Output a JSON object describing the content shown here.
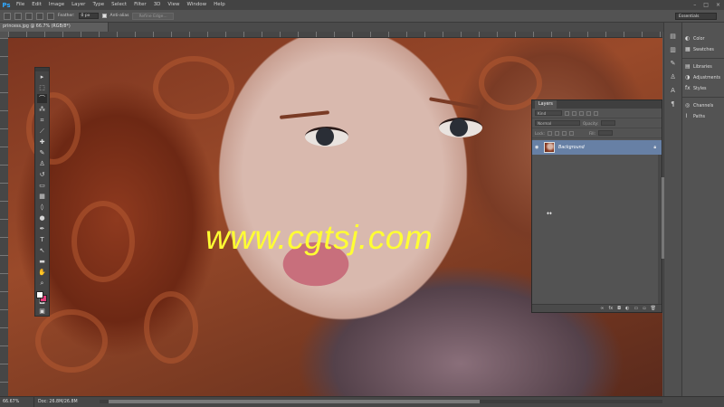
{
  "app": {
    "logo": "Ps"
  },
  "menu": [
    "File",
    "Edit",
    "Image",
    "Layer",
    "Type",
    "Select",
    "Filter",
    "3D",
    "View",
    "Window",
    "Help"
  ],
  "window_controls": [
    "–",
    "□",
    "×"
  ],
  "options_bar": {
    "feather_label": "Feather:",
    "feather_value": "0 px",
    "antialias_label": "Anti-alias",
    "refine_edge_label": "Refine Edge..."
  },
  "workspace": "Essentials",
  "document": {
    "tab_title": "princess.jpg @ 66.7% (RGB/8*)"
  },
  "watermark": "www.cgtsj.com",
  "toolbar": {
    "tools": [
      {
        "name": "move-tool",
        "glyph": "▸"
      },
      {
        "name": "marquee-tool",
        "glyph": "⬚"
      },
      {
        "name": "lasso-tool",
        "glyph": "⌒"
      },
      {
        "name": "quick-select-tool",
        "glyph": "⁂"
      },
      {
        "name": "crop-tool",
        "glyph": "⌗"
      },
      {
        "name": "eyedropper-tool",
        "glyph": "⟋"
      },
      {
        "name": "healing-brush-tool",
        "glyph": "✚"
      },
      {
        "name": "brush-tool",
        "glyph": "✎"
      },
      {
        "name": "clone-stamp-tool",
        "glyph": "♙"
      },
      {
        "name": "history-brush-tool",
        "glyph": "↺"
      },
      {
        "name": "eraser-tool",
        "glyph": "▭"
      },
      {
        "name": "gradient-tool",
        "glyph": "▦"
      },
      {
        "name": "blur-tool",
        "glyph": "◊"
      },
      {
        "name": "dodge-tool",
        "glyph": "●"
      },
      {
        "name": "pen-tool",
        "glyph": "✒"
      },
      {
        "name": "type-tool",
        "glyph": "T"
      },
      {
        "name": "path-select-tool",
        "glyph": "↖"
      },
      {
        "name": "rectangle-tool",
        "glyph": "▬"
      },
      {
        "name": "hand-tool",
        "glyph": "✋"
      },
      {
        "name": "zoom-tool",
        "glyph": "⌕"
      }
    ],
    "extra": [
      {
        "name": "quick-mask-button",
        "glyph": "◙"
      },
      {
        "name": "screen-mode-button",
        "glyph": "▣"
      }
    ]
  },
  "dock": {
    "items": [
      {
        "name": "color",
        "label": "Color",
        "glyph": "◐"
      },
      {
        "name": "swatches",
        "label": "Swatches",
        "glyph": "▦"
      },
      {
        "name": "libraries",
        "label": "Libraries",
        "glyph": "▤"
      },
      {
        "name": "adjustments",
        "label": "Adjustments",
        "glyph": "◑"
      },
      {
        "name": "styles",
        "label": "Styles",
        "glyph": "fx"
      },
      {
        "name": "channels",
        "label": "Channels",
        "glyph": "◎"
      },
      {
        "name": "paths",
        "label": "Paths",
        "glyph": "⌇"
      }
    ]
  },
  "layers_panel": {
    "tab": "Layers",
    "filter_kind": "Kind",
    "blend_mode": "Normal",
    "opacity_label": "Opacity:",
    "lock_label": "Lock:",
    "fill_label": "Fill:",
    "layer": {
      "name": "Background"
    }
  },
  "status": {
    "zoom": "66.67%",
    "doc_size": "Doc: 26.8M/26.8M"
  }
}
